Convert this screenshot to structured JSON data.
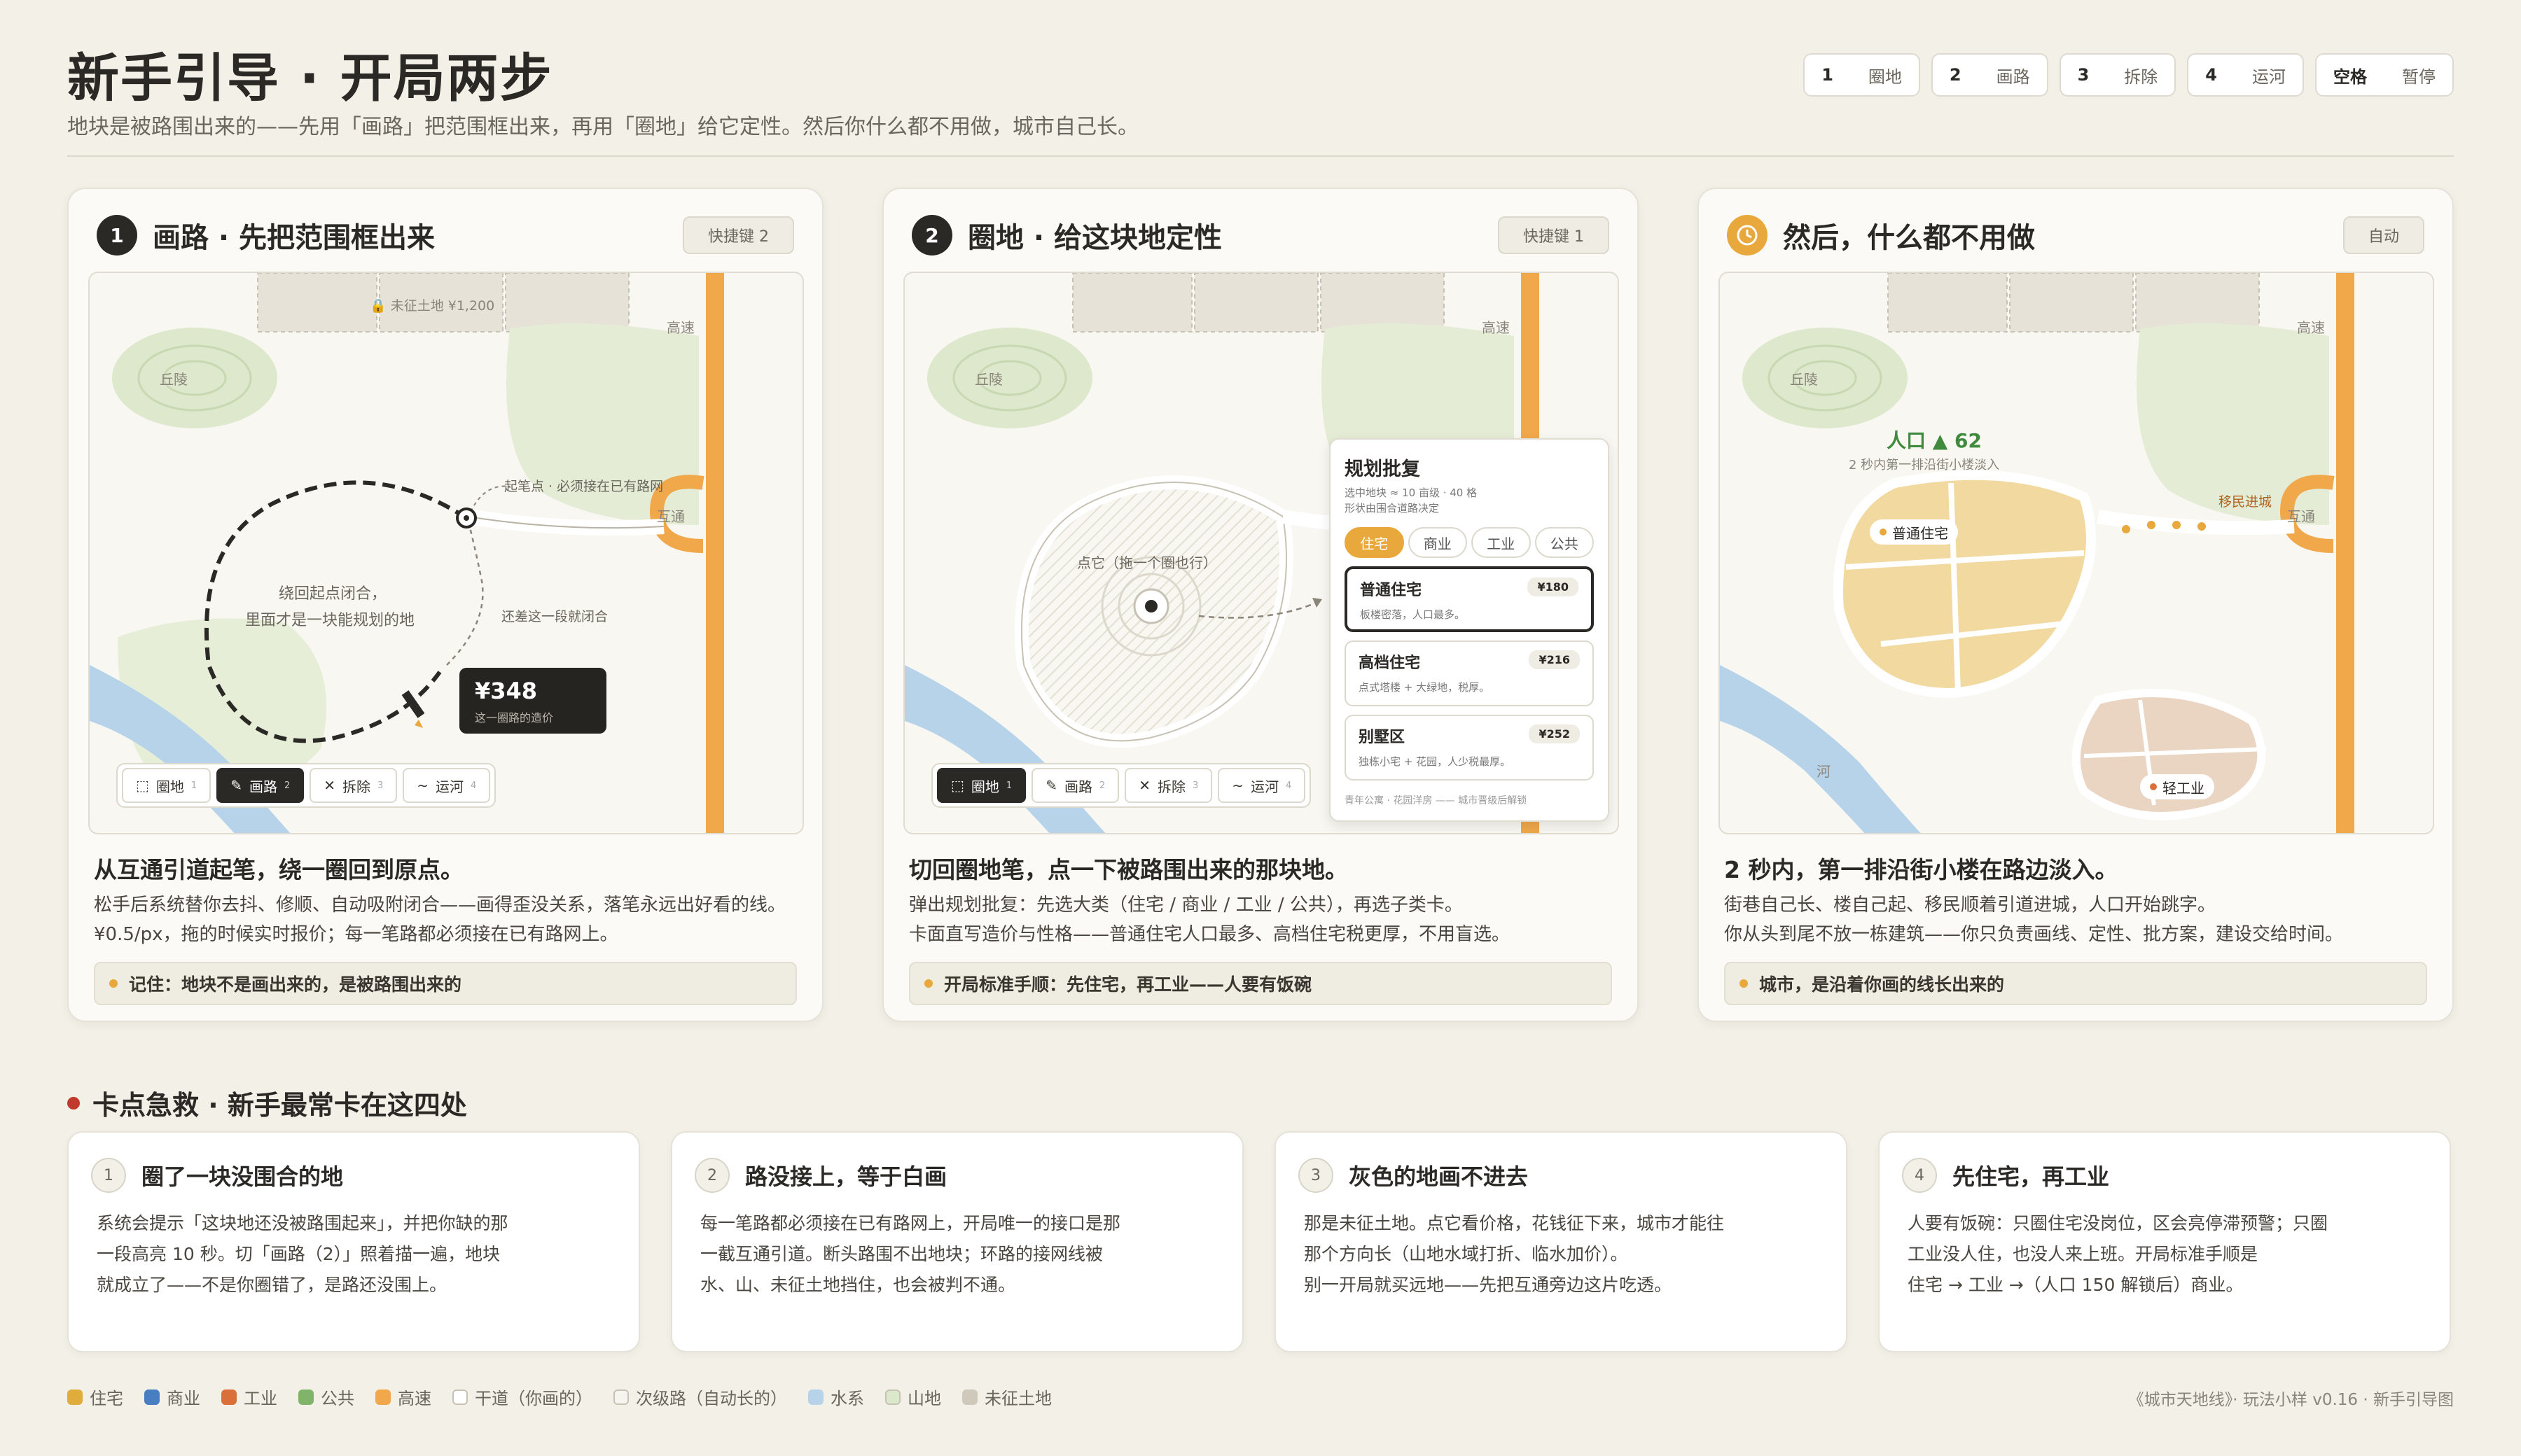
{
  "header": {
    "title": "新手引导 · 开局两步",
    "subtitle": "地块是被路围出来的——先用「画路」把范围框出来，再用「圈地」给它定性。然后你什么都不用做，城市自己长。"
  },
  "hotkeys": [
    {
      "key": "1",
      "label": "圈地"
    },
    {
      "key": "2",
      "label": "画路"
    },
    {
      "key": "3",
      "label": "拆除"
    },
    {
      "key": "4",
      "label": "运河"
    },
    {
      "key": "空格",
      "label": "暂停"
    }
  ],
  "map_labels": {
    "hill": "丘陵",
    "highway": "高速",
    "interchange": "互通",
    "river": "河",
    "locked_land": "未征土地 ¥1,200"
  },
  "toolbar": [
    {
      "label": "圈地",
      "key": "1"
    },
    {
      "label": "画路",
      "key": "2"
    },
    {
      "label": "拆除",
      "key": "3"
    },
    {
      "label": "运河",
      "key": "4"
    }
  ],
  "cards": [
    {
      "num": "1",
      "title": "画路 · 先把范围框出来",
      "tag": "快捷键 2",
      "annotations": {
        "start": "起笔点 · 必须接在已有路网",
        "mid": "还差这一段就闭合",
        "inside_1": "绕回起点闭合，",
        "inside_2": "里面才是一块能规划的地"
      },
      "price": {
        "value": "¥348",
        "sub": "这一圈路的造价"
      },
      "h3": "从互通引道起笔，绕一圈回到原点。",
      "p1": "松手后系统替你去抖、修顺、自动吸附闭合——画得歪没关系，落笔永远出好看的线。",
      "p2": "¥0.5/px，拖的时候实时报价；每一笔路都必须接在已有路网上。",
      "note": "记住：地块不是画出来的，是被路围出来的"
    },
    {
      "num": "2",
      "title": "圈地 · 给这块地定性",
      "tag": "快捷键 1",
      "annotations": {
        "click": "点它（拖一个圈也行）"
      },
      "panel": {
        "title": "规划批复",
        "sub1": "选中地块 ≈ 10 亩级 · 40 格",
        "sub2": "形状由围合道路决定",
        "tabs": [
          "住宅",
          "商业",
          "工业",
          "公共"
        ],
        "options": [
          {
            "name": "普通住宅",
            "desc": "板楼密落，人口最多。",
            "price": "¥180"
          },
          {
            "name": "高档住宅",
            "desc": "点式塔楼 + 大绿地，税厚。",
            "price": "¥216"
          },
          {
            "name": "别墅区",
            "desc": "独栋小宅 + 花园，人少税最厚。",
            "price": "¥252"
          }
        ],
        "footer": "青年公寓 · 花园洋房 —— 城市晋级后解锁"
      },
      "h3": "切回圈地笔，点一下被路围出来的那块地。",
      "p1": "弹出规划批复：先选大类（住宅 / 商业 / 工业 / 公共），再选子类卡。",
      "p2": "卡面直写造价与性格——普通住宅人口最多、高档住宅税更厚，不用盲选。",
      "note": "开局标准手顺：先住宅，再工业——人要有饭碗"
    },
    {
      "num": "",
      "title": "然后，什么都不用做",
      "tag": "自动",
      "annotations": {
        "pop": "人口 ▲ 62",
        "pop_sub": "2 秒内第一排沿街小楼淡入",
        "migrants": "移民进城",
        "zone_res": "普通住宅",
        "zone_ind": "轻工业"
      },
      "h3": "2 秒内，第一排沿街小楼在路边淡入。",
      "p1": "街巷自己长、楼自己起、移民顺着引道进城，人口开始跳字。",
      "p2": "你从头到尾不放一栋建筑——你只负责画线、定性、批方案，建设交给时间。",
      "note": "城市，是沿着你画的线长出来的"
    }
  ],
  "section": {
    "title": "卡点急救 · 新手最常卡在这四处"
  },
  "tips": [
    {
      "num": "1",
      "title": "圈了一块没围合的地",
      "lines": [
        "系统会提示「这块地还没被路围起来」，并把你缺的那",
        "一段高亮 10 秒。切「画路（2）」照着描一遍，地块",
        "就成立了——不是你圈错了，是路还没围上。"
      ]
    },
    {
      "num": "2",
      "title": "路没接上，等于白画",
      "lines": [
        "每一笔路都必须接在已有路网上，开局唯一的接口是那",
        "一截互通引道。断头路围不出地块；环路的接网线被",
        "水、山、未征土地挡住，也会被判不通。"
      ]
    },
    {
      "num": "3",
      "title": "灰色的地画不进去",
      "lines": [
        "那是未征土地。点它看价格，花钱征下来，城市才能往",
        "那个方向长（山地水域打折、临水加价）。",
        "别一开局就买远地——先把互通旁边这片吃透。"
      ]
    },
    {
      "num": "4",
      "title": "先住宅，再工业",
      "lines": [
        "人要有饭碗：只圈住宅没岗位，区会亮停滞预警；只圈",
        "工业没人住，也没人来上班。开局标准手顺是",
        "住宅 → 工业 →（人口 150 解锁后）商业。"
      ]
    }
  ],
  "legend": [
    {
      "label": "住宅",
      "color": "#e0ad3d",
      "style": "fill"
    },
    {
      "label": "商业",
      "color": "#4a7ec2",
      "style": "fill"
    },
    {
      "label": "工业",
      "color": "#d9703a",
      "style": "fill"
    },
    {
      "label": "公共",
      "color": "#7fb46a",
      "style": "fill"
    },
    {
      "label": "高速",
      "color": "#f0a84a",
      "style": "fill"
    },
    {
      "label": "干道（你画的）",
      "color": "#ffffff",
      "style": "outline"
    },
    {
      "label": "次级路（自动长的）",
      "color": "#f6f4ee",
      "style": "outline"
    },
    {
      "label": "水系",
      "color": "#b7d3ea",
      "style": "fill"
    },
    {
      "label": "山地",
      "color": "#dce8cc",
      "style": "outline"
    },
    {
      "label": "未征土地",
      "color": "#cfc9bb",
      "style": "fill"
    }
  ],
  "footer": "《城市天地线》· 玩法小样 v0.16 · 新手引导图"
}
